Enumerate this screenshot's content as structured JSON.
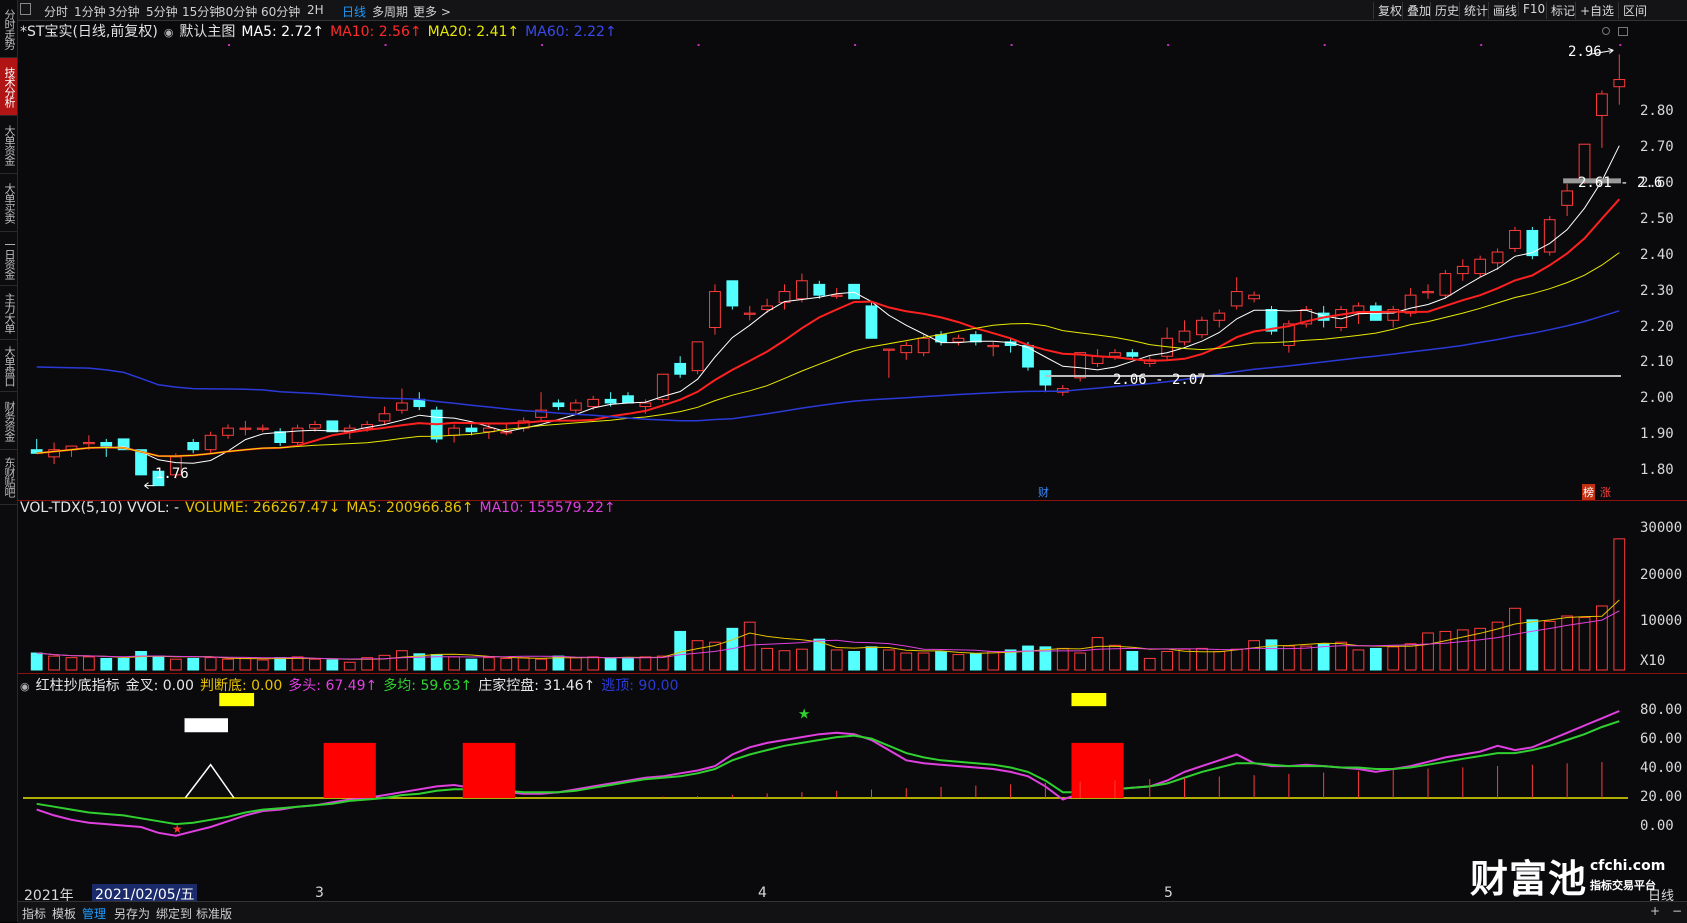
{
  "left_tabs": [
    {
      "label": "分时走势",
      "active": false
    },
    {
      "label": "技术分析",
      "active": true
    },
    {
      "label": "大单资金",
      "active": false
    },
    {
      "label": "大单买卖",
      "active": false
    },
    {
      "label": "一日资金",
      "active": false
    },
    {
      "label": "主力大单",
      "active": false
    },
    {
      "label": "大单盘口",
      "active": false
    },
    {
      "label": "财务资金",
      "active": false
    },
    {
      "label": "东财贴吧",
      "active": false
    }
  ],
  "toolbar": {
    "periods": [
      "分时",
      "1分钟",
      "3分钟",
      "5分钟",
      "15分钟",
      "30分钟",
      "60分钟",
      "2H",
      "日线",
      "多周期",
      "更多 >"
    ],
    "active_period": "日线",
    "right_buttons": [
      "复权",
      "叠加",
      "历史",
      "统计",
      "画线",
      "F10",
      "标记",
      "+自选",
      "区间"
    ]
  },
  "main_legend": {
    "title": "*ST宝实(日线,前复权)",
    "template": "默认主图",
    "ma5": "MA5: 2.72↑",
    "ma10": "MA10: 2.56↑",
    "ma20": "MA20: 2.41↑",
    "ma60": "MA60: 2.22↑"
  },
  "price_axis": [
    "2.80",
    "2.70",
    "2.60",
    "2.50",
    "2.40",
    "2.30",
    "2.20",
    "2.10",
    "2.00",
    "1.90",
    "1.80"
  ],
  "price_annotations": {
    "high": "2.96",
    "low": "1.76",
    "gap1": "2.61 - 2.6",
    "gap2": "2.06 - 2.07",
    "marker_cai": "财",
    "marker_bang": "榜",
    "marker_zhang": "涨"
  },
  "vol_legend": {
    "name": "VOL-TDX(5,10) VVOL: -",
    "volume": "VOLUME: 266267.47↓",
    "ma5": "MA5: 200966.86↑",
    "ma10": "MA10: 155579.22↑"
  },
  "vol_axis": [
    "30000",
    "20000",
    "10000",
    "X10"
  ],
  "ind_legend": {
    "name": "红柱抄底指标",
    "jincha": "金叉: 0.00",
    "panduandi": "判断底: 0.00",
    "duotou": "多头: 67.49↑",
    "duojun": "多均: 59.63↑",
    "zhuang": "庄家控盘: 31.46↑",
    "taoding": "逃顶: 90.00"
  },
  "ind_axis": [
    "80.00",
    "60.00",
    "40.00",
    "20.00",
    "0.00"
  ],
  "date_axis": {
    "year": "2021年",
    "cursor": "2021/02/05/五",
    "months": [
      "3",
      "4",
      "5",
      "6"
    ],
    "right": "日线"
  },
  "bottom_tabs": [
    "指标",
    "模板",
    "管理",
    "另存为",
    "绑定到",
    "标准版"
  ],
  "bottom_active": "管理",
  "watermark": {
    "brand": "财富池",
    "domain": "cfchi.com",
    "slogan": "指标交易平台"
  },
  "colors": {
    "up": "#ff3b3b",
    "down": "#54ffff",
    "ma5": "#ffffff",
    "ma10": "#ff2020",
    "ma20": "#e8e800",
    "ma60": "#2a3ad8",
    "purple": "#e040e0",
    "green": "#30d030"
  },
  "chart_data": {
    "type": "candlestick",
    "x_range": [
      "2021-01-25",
      "2021-06-18"
    ],
    "ylim": [
      1.76,
      2.96
    ],
    "ohlc": [
      {
        "o": 1.86,
        "h": 1.89,
        "l": 1.85,
        "c": 1.85
      },
      {
        "o": 1.84,
        "h": 1.88,
        "l": 1.82,
        "c": 1.86
      },
      {
        "o": 1.86,
        "h": 1.87,
        "l": 1.84,
        "c": 1.87
      },
      {
        "o": 1.88,
        "h": 1.9,
        "l": 1.86,
        "c": 1.88
      },
      {
        "o": 1.88,
        "h": 1.89,
        "l": 1.84,
        "c": 1.87
      },
      {
        "o": 1.89,
        "h": 1.89,
        "l": 1.86,
        "c": 1.86
      },
      {
        "o": 1.86,
        "h": 1.86,
        "l": 1.79,
        "c": 1.79
      },
      {
        "o": 1.8,
        "h": 1.8,
        "l": 1.76,
        "c": 1.76
      },
      {
        "o": 1.79,
        "h": 1.85,
        "l": 1.78,
        "c": 1.84
      },
      {
        "o": 1.88,
        "h": 1.89,
        "l": 1.85,
        "c": 1.86
      },
      {
        "o": 1.86,
        "h": 1.91,
        "l": 1.85,
        "c": 1.9
      },
      {
        "o": 1.9,
        "h": 1.93,
        "l": 1.89,
        "c": 1.92
      },
      {
        "o": 1.92,
        "h": 1.94,
        "l": 1.9,
        "c": 1.92
      },
      {
        "o": 1.92,
        "h": 1.93,
        "l": 1.91,
        "c": 1.92
      },
      {
        "o": 1.91,
        "h": 1.92,
        "l": 1.87,
        "c": 1.88
      },
      {
        "o": 1.88,
        "h": 1.93,
        "l": 1.87,
        "c": 1.92
      },
      {
        "o": 1.92,
        "h": 1.94,
        "l": 1.91,
        "c": 1.93
      },
      {
        "o": 1.94,
        "h": 1.94,
        "l": 1.91,
        "c": 1.91
      },
      {
        "o": 1.91,
        "h": 1.93,
        "l": 1.89,
        "c": 1.92
      },
      {
        "o": 1.92,
        "h": 1.94,
        "l": 1.91,
        "c": 1.93
      },
      {
        "o": 1.94,
        "h": 1.98,
        "l": 1.93,
        "c": 1.96
      },
      {
        "o": 1.97,
        "h": 2.03,
        "l": 1.96,
        "c": 1.99
      },
      {
        "o": 2.0,
        "h": 2.02,
        "l": 1.97,
        "c": 1.98
      },
      {
        "o": 1.97,
        "h": 1.98,
        "l": 1.88,
        "c": 1.89
      },
      {
        "o": 1.9,
        "h": 1.93,
        "l": 1.88,
        "c": 1.92
      },
      {
        "o": 1.92,
        "h": 1.93,
        "l": 1.9,
        "c": 1.91
      },
      {
        "o": 1.91,
        "h": 1.93,
        "l": 1.89,
        "c": 1.92
      },
      {
        "o": 1.91,
        "h": 1.93,
        "l": 1.9,
        "c": 1.91
      },
      {
        "o": 1.92,
        "h": 1.95,
        "l": 1.91,
        "c": 1.94
      },
      {
        "o": 1.95,
        "h": 2.02,
        "l": 1.94,
        "c": 1.97
      },
      {
        "o": 1.99,
        "h": 2.0,
        "l": 1.97,
        "c": 1.98
      },
      {
        "o": 1.97,
        "h": 2.0,
        "l": 1.96,
        "c": 1.99
      },
      {
        "o": 1.98,
        "h": 2.01,
        "l": 1.97,
        "c": 2.0
      },
      {
        "o": 2.0,
        "h": 2.02,
        "l": 1.98,
        "c": 1.99
      },
      {
        "o": 2.01,
        "h": 2.02,
        "l": 1.99,
        "c": 1.99
      },
      {
        "o": 1.98,
        "h": 2.0,
        "l": 1.96,
        "c": 1.99
      },
      {
        "o": 2.0,
        "h": 2.07,
        "l": 1.99,
        "c": 2.07
      },
      {
        "o": 2.1,
        "h": 2.12,
        "l": 2.06,
        "c": 2.07
      },
      {
        "o": 2.08,
        "h": 2.16,
        "l": 2.07,
        "c": 2.16
      },
      {
        "o": 2.2,
        "h": 2.32,
        "l": 2.18,
        "c": 2.3
      },
      {
        "o": 2.33,
        "h": 2.33,
        "l": 2.25,
        "c": 2.26
      },
      {
        "o": 2.24,
        "h": 2.26,
        "l": 2.22,
        "c": 2.24
      },
      {
        "o": 2.25,
        "h": 2.28,
        "l": 2.24,
        "c": 2.26
      },
      {
        "o": 2.27,
        "h": 2.32,
        "l": 2.25,
        "c": 2.3
      },
      {
        "o": 2.28,
        "h": 2.35,
        "l": 2.27,
        "c": 2.33
      },
      {
        "o": 2.32,
        "h": 2.33,
        "l": 2.28,
        "c": 2.29
      },
      {
        "o": 2.29,
        "h": 2.31,
        "l": 2.28,
        "c": 2.29
      },
      {
        "o": 2.32,
        "h": 2.31,
        "l": 2.28,
        "c": 2.28
      },
      {
        "o": 2.26,
        "h": 2.27,
        "l": 2.17,
        "c": 2.17
      },
      {
        "o": 2.14,
        "h": 2.14,
        "l": 2.06,
        "c": 2.14
      },
      {
        "o": 2.13,
        "h": 2.16,
        "l": 2.11,
        "c": 2.15
      },
      {
        "o": 2.13,
        "h": 2.18,
        "l": 2.12,
        "c": 2.17
      },
      {
        "o": 2.18,
        "h": 2.19,
        "l": 2.15,
        "c": 2.16
      },
      {
        "o": 2.16,
        "h": 2.18,
        "l": 2.15,
        "c": 2.17
      },
      {
        "o": 2.18,
        "h": 2.19,
        "l": 2.15,
        "c": 2.16
      },
      {
        "o": 2.15,
        "h": 2.16,
        "l": 2.12,
        "c": 2.15
      },
      {
        "o": 2.16,
        "h": 2.17,
        "l": 2.13,
        "c": 2.15
      },
      {
        "o": 2.15,
        "h": 2.16,
        "l": 2.08,
        "c": 2.09
      },
      {
        "o": 2.08,
        "h": 2.08,
        "l": 2.02,
        "c": 2.04
      },
      {
        "o": 2.02,
        "h": 2.04,
        "l": 2.01,
        "c": 2.03
      },
      {
        "o": 2.06,
        "h": 2.13,
        "l": 2.05,
        "c": 2.13
      },
      {
        "o": 2.1,
        "h": 2.14,
        "l": 2.09,
        "c": 2.12
      },
      {
        "o": 2.12,
        "h": 2.14,
        "l": 2.11,
        "c": 2.13
      },
      {
        "o": 2.13,
        "h": 2.14,
        "l": 2.11,
        "c": 2.12
      },
      {
        "o": 2.1,
        "h": 2.12,
        "l": 2.09,
        "c": 2.11
      },
      {
        "o": 2.12,
        "h": 2.2,
        "l": 2.11,
        "c": 2.17
      },
      {
        "o": 2.16,
        "h": 2.22,
        "l": 2.15,
        "c": 2.19
      },
      {
        "o": 2.18,
        "h": 2.23,
        "l": 2.17,
        "c": 2.22
      },
      {
        "o": 2.22,
        "h": 2.25,
        "l": 2.2,
        "c": 2.24
      },
      {
        "o": 2.26,
        "h": 2.34,
        "l": 2.25,
        "c": 2.3
      },
      {
        "o": 2.28,
        "h": 2.3,
        "l": 2.27,
        "c": 2.29
      },
      {
        "o": 2.25,
        "h": 2.26,
        "l": 2.18,
        "c": 2.19
      },
      {
        "o": 2.15,
        "h": 2.22,
        "l": 2.13,
        "c": 2.21
      },
      {
        "o": 2.21,
        "h": 2.26,
        "l": 2.2,
        "c": 2.25
      },
      {
        "o": 2.24,
        "h": 2.26,
        "l": 2.2,
        "c": 2.22
      },
      {
        "o": 2.2,
        "h": 2.26,
        "l": 2.19,
        "c": 2.25
      },
      {
        "o": 2.24,
        "h": 2.27,
        "l": 2.21,
        "c": 2.26
      },
      {
        "o": 2.26,
        "h": 2.27,
        "l": 2.22,
        "c": 2.22
      },
      {
        "o": 2.22,
        "h": 2.26,
        "l": 2.2,
        "c": 2.25
      },
      {
        "o": 2.24,
        "h": 2.31,
        "l": 2.23,
        "c": 2.29
      },
      {
        "o": 2.3,
        "h": 2.32,
        "l": 2.28,
        "c": 2.3
      },
      {
        "o": 2.29,
        "h": 2.36,
        "l": 2.28,
        "c": 2.35
      },
      {
        "o": 2.35,
        "h": 2.39,
        "l": 2.33,
        "c": 2.37
      },
      {
        "o": 2.35,
        "h": 2.4,
        "l": 2.34,
        "c": 2.39
      },
      {
        "o": 2.38,
        "h": 2.42,
        "l": 2.36,
        "c": 2.41
      },
      {
        "o": 2.42,
        "h": 2.48,
        "l": 2.41,
        "c": 2.47
      },
      {
        "o": 2.47,
        "h": 2.48,
        "l": 2.39,
        "c": 2.4
      },
      {
        "o": 2.41,
        "h": 2.51,
        "l": 2.4,
        "c": 2.5
      },
      {
        "o": 2.54,
        "h": 2.6,
        "l": 2.51,
        "c": 2.58
      },
      {
        "o": 2.61,
        "h": 2.71,
        "l": 2.6,
        "c": 2.71
      },
      {
        "o": 2.79,
        "h": 2.86,
        "l": 2.7,
        "c": 2.85
      },
      {
        "o": 2.87,
        "h": 2.96,
        "l": 2.82,
        "c": 2.89
      }
    ],
    "volume_ratio_estimate": "relative heights read from the volume panel (units x10)"
  }
}
